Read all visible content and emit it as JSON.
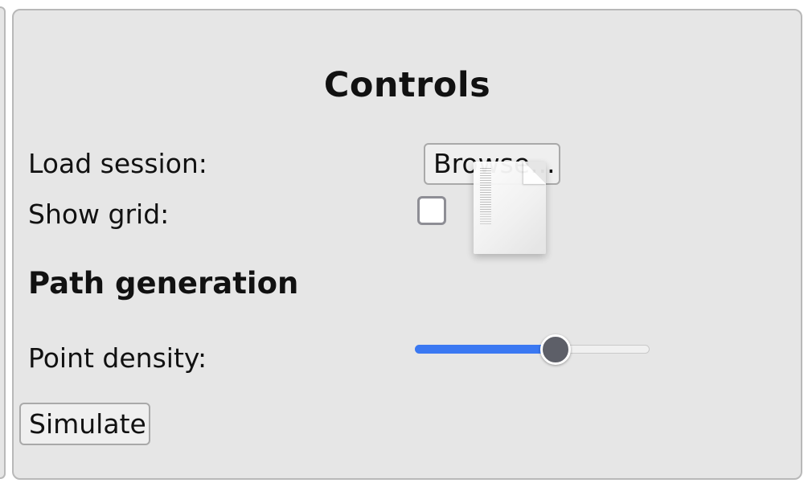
{
  "panel": {
    "title": "Controls"
  },
  "load_session": {
    "label": "Load session:",
    "button_label": "Browse..."
  },
  "show_grid": {
    "label": "Show grid:",
    "checked": false
  },
  "path_generation": {
    "title": "Path generation",
    "point_density": {
      "label": "Point density:",
      "value_fraction": 0.6
    }
  },
  "actions": {
    "simulate_label": "Simulate"
  },
  "drag": {
    "icon": "document-icon"
  },
  "colors": {
    "panel_bg": "#e6e6e6",
    "slider_fill": "#3a78f2",
    "slider_thumb": "#5d5f68"
  }
}
